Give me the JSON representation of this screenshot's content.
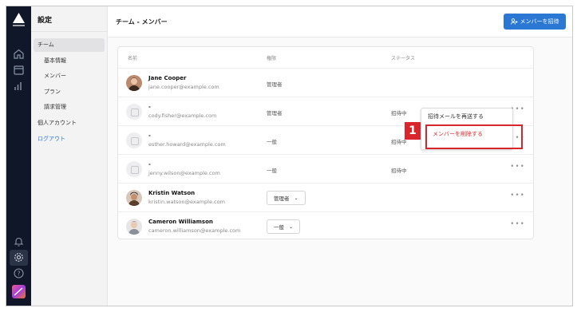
{
  "sidebar": {
    "title": "設定",
    "items": [
      {
        "label": "チーム"
      },
      {
        "label": "基本情報"
      },
      {
        "label": "メンバー"
      },
      {
        "label": "プラン"
      },
      {
        "label": "請求管理"
      },
      {
        "label": "個人アカウント"
      },
      {
        "label": "ログアウト"
      }
    ]
  },
  "header": {
    "title": "チーム - メンバー",
    "invite_label": "メンバーを招待"
  },
  "table": {
    "headers": {
      "name": "名前",
      "role": "権限",
      "status": "ステータス"
    },
    "rows": [
      {
        "name": "Jane Cooper",
        "email": "jane.cooper@example.com",
        "role": "管理者",
        "status": ""
      },
      {
        "name": "-",
        "email": "cody.fisher@example.com",
        "role": "管理者",
        "status": "招待中"
      },
      {
        "name": "-",
        "email": "esther.howard@example.com",
        "role": "一般",
        "status": "招待中"
      },
      {
        "name": "-",
        "email": "jenny.wilson@example.com",
        "role": "一般",
        "status": "招待中"
      },
      {
        "name": "Kristin Watson",
        "email": "kristin.watson@example.com",
        "role": "管理者",
        "status": ""
      },
      {
        "name": "Cameron Williamson",
        "email": "cameron.williamson@example.com",
        "role": "一般",
        "status": ""
      }
    ]
  },
  "menu": {
    "resend": "招待メールを再送する",
    "delete": "メンバーを削除する"
  },
  "annotation": {
    "step": "1"
  },
  "colors": {
    "accent": "#2b78d4",
    "highlight": "#d9262c",
    "rail": "#0f1729"
  }
}
